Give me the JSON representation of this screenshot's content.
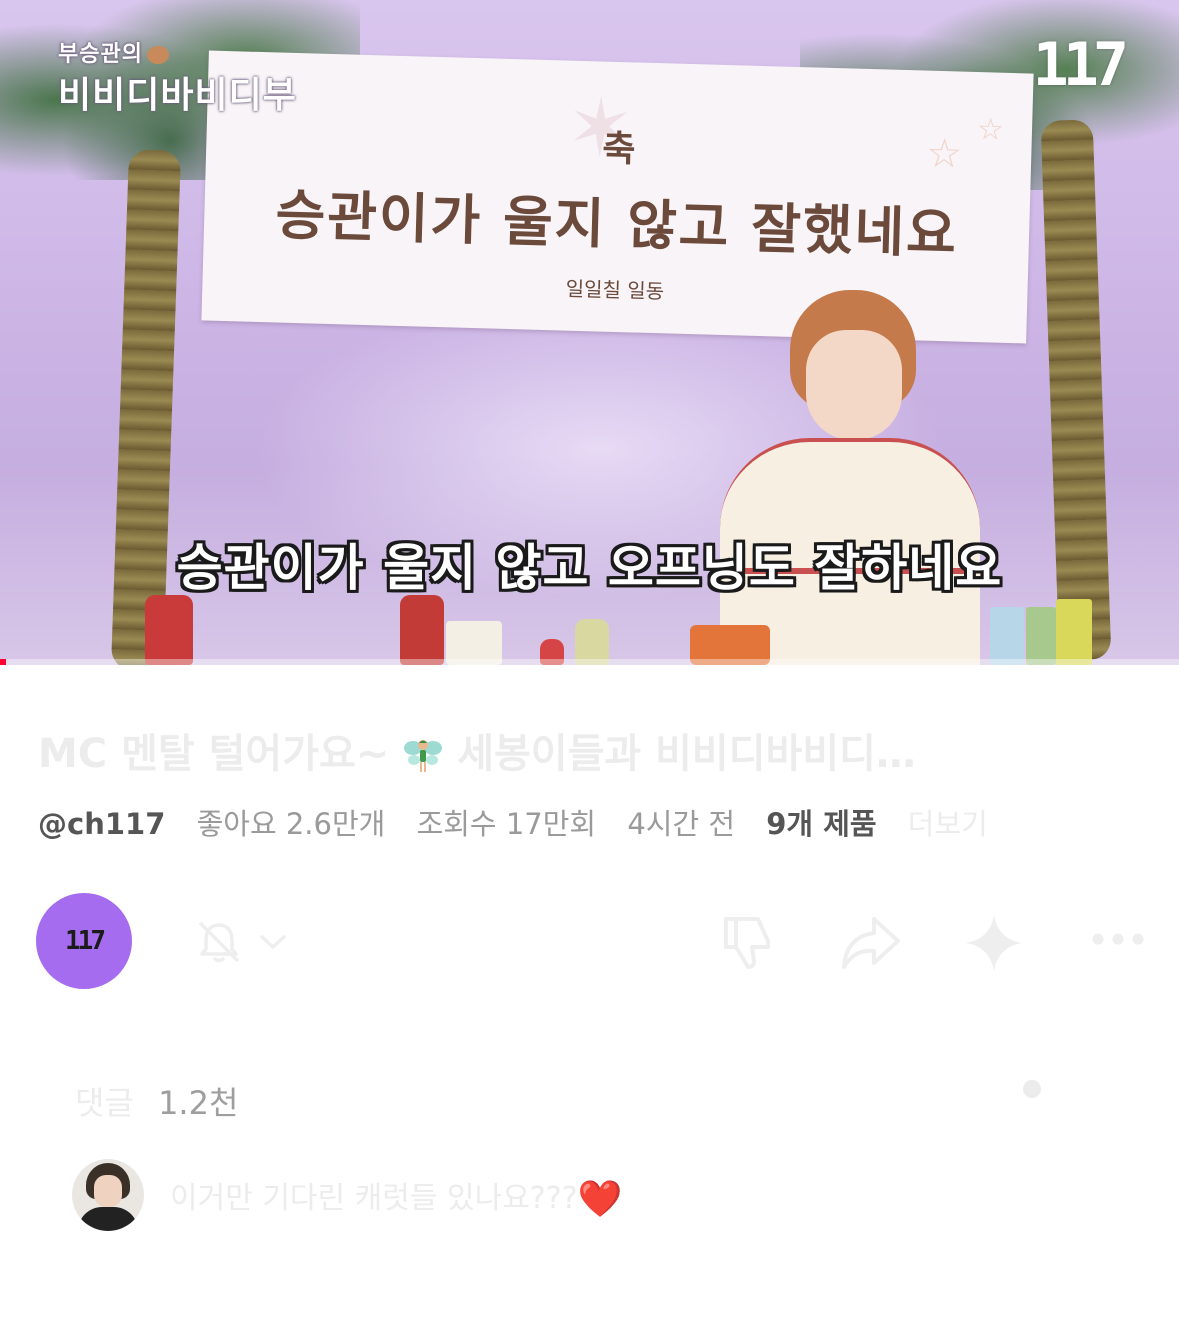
{
  "video": {
    "show_logo_line1": "부승관의",
    "show_logo_line2": "비비디바비디부",
    "channel_mark": "117",
    "banner_small": "축",
    "banner_main": "승관이가 울지 않고 잘했네요",
    "banner_sub": "일일칠 일동",
    "subtitle": "승관이가 울지 않고 오프닝도 잘하네요",
    "progress_fraction": 0.005
  },
  "info": {
    "title_prefix": "MC 멘탈 털어가요~",
    "title_suffix": "세봉이들과 비비디바비디…",
    "channel_handle": "@ch117",
    "likes": "좋아요 2.6만개",
    "views": "조회수 17만회",
    "time": "4시간 전",
    "products": "9개 제품",
    "more": "더보기"
  },
  "channel_avatar_label": "117",
  "comments": {
    "label": "댓글",
    "count": "1.2천",
    "first_text": "이거만 기다린 캐럿들 있나요???",
    "first_emoji": "❤️"
  },
  "icons": [
    "bell-icon",
    "chevron-down-icon",
    "dislike-icon",
    "share-icon",
    "sparkle-icon",
    "more-icon"
  ],
  "colors": {
    "progress": "#ff0033",
    "avatar_bg": "#a56cf0"
  }
}
